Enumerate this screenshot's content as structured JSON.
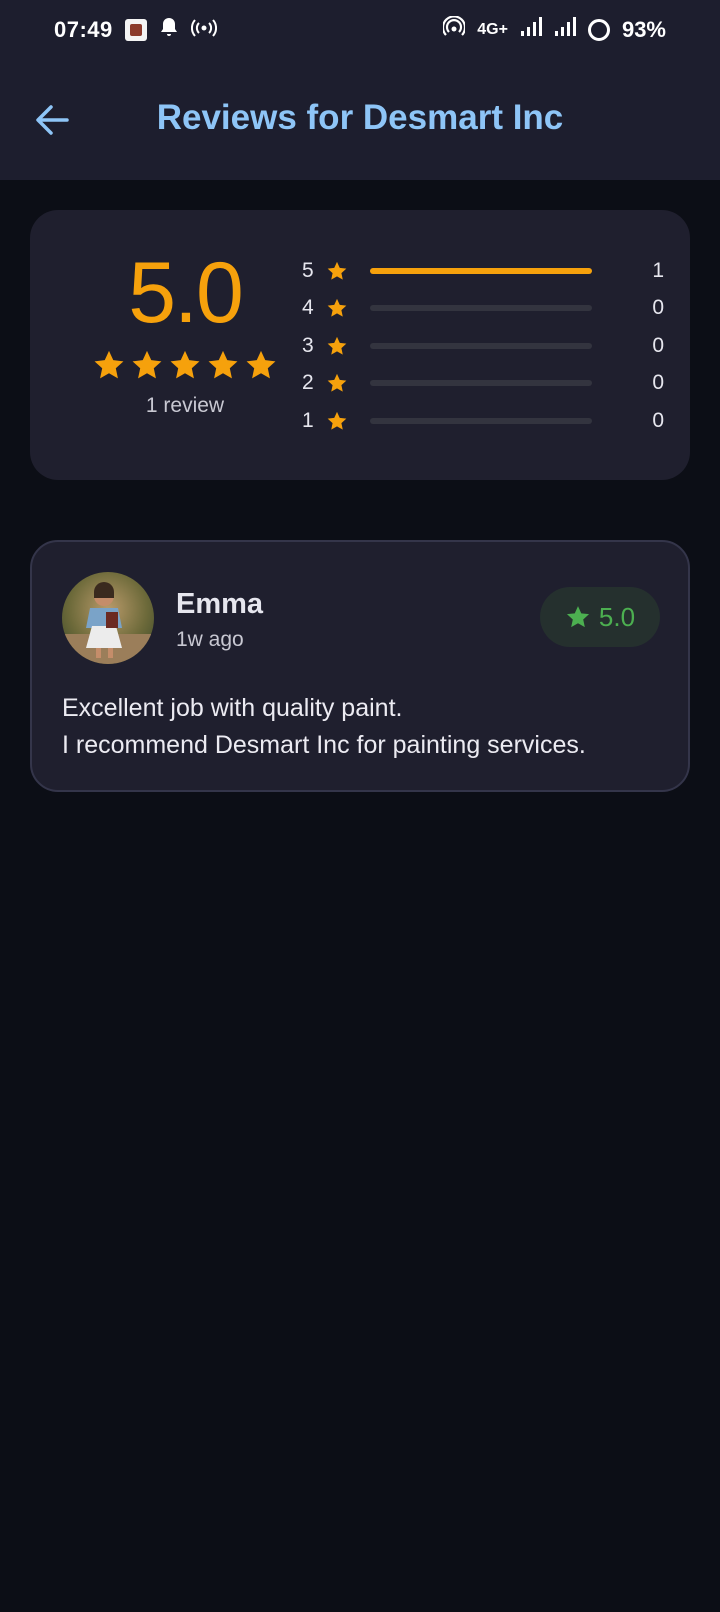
{
  "status_bar": {
    "time": "07:49",
    "network": "4G+",
    "battery": "93%"
  },
  "app_bar": {
    "title": "Reviews for Desmart Inc",
    "back_icon": "arrow-left-icon"
  },
  "summary": {
    "average": "5.0",
    "stars_filled": 5,
    "review_count_label": "1 review",
    "distribution": [
      {
        "stars": "5",
        "count": "1",
        "fraction": 1.0
      },
      {
        "stars": "4",
        "count": "0",
        "fraction": 0
      },
      {
        "stars": "3",
        "count": "0",
        "fraction": 0
      },
      {
        "stars": "2",
        "count": "0",
        "fraction": 0
      },
      {
        "stars": "1",
        "count": "0",
        "fraction": 0
      }
    ]
  },
  "reviews": [
    {
      "name": "Emma",
      "time": "1w ago",
      "rating": "5.0",
      "text": "Excellent job with quality paint.\nI recommend Desmart Inc for painting services."
    }
  ],
  "colors": {
    "accent": "#f6a10c",
    "title": "#8ec5f7",
    "rating_green": "#4caf50",
    "background": "#0c0e16",
    "card": "#1f1f2e"
  }
}
